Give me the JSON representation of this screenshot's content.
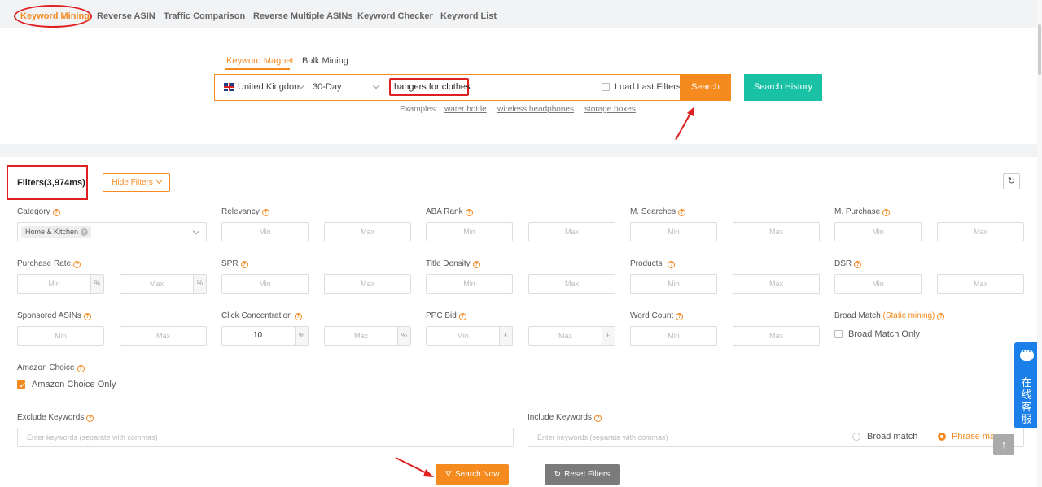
{
  "top_tabs": [
    "Keyword Mining",
    "Reverse ASIN",
    "Traffic Comparison",
    "Reverse Multiple ASINs",
    "Keyword Checker",
    "Keyword List"
  ],
  "sub_tabs": [
    "Keyword Magnet",
    "Bulk Mining"
  ],
  "search": {
    "marketplace": "United Kingdon",
    "period": "30-Day",
    "keyword": "hangers for clothes",
    "load_last_filters": "Load Last Filters",
    "search_button": "Search",
    "history_button": "Search History",
    "examples_label": "Examples:",
    "examples": [
      "water bottle",
      "wireless headphones",
      "storage boxes"
    ]
  },
  "filters": {
    "title": "Filters(3,974ms)",
    "hide_button": "Hide Filters",
    "category_label": "Category",
    "category_chip": "Home & Kitchen",
    "relevancy": "Relevancy",
    "aba_rank": "ABA Rank",
    "m_searches": "M. Searches",
    "m_purchase": "M. Purchase",
    "purchase_rate": "Purchase Rate",
    "spr": "SPR",
    "title_density": "Title Density",
    "products": "Products",
    "dsr": "DSR",
    "sponsored_asins": "Sponsored ASINs",
    "click_concentration": "Click Concentration",
    "click_concentration_min": "10",
    "ppc_bid": "PPC Bid",
    "word_count": "Word Count",
    "broad_match": "Broad Match",
    "broad_match_static": "(Static mining)",
    "broad_match_only": "Broad Match Only",
    "amazon_choice": "Amazon Choice",
    "amazon_choice_only": "Amazon Choice Only",
    "exclude_keywords": "Exclude Keywords",
    "include_keywords": "Include Keywords",
    "keywords_placeholder": "Enter keywords (separate with commas)",
    "broad_match_option": "Broad match",
    "phrase_match_option": "Phrase ma",
    "min": "Min",
    "max": "Max",
    "percent": "%",
    "pound": "£",
    "search_now": "Search Now",
    "reset_filters": "Reset Filters"
  },
  "chat_widget": "在线客服",
  "colors": {
    "accent": "#f58a1f",
    "teal": "#19c1a5",
    "annotation": "#e02020",
    "chat": "#1a7fe8"
  }
}
